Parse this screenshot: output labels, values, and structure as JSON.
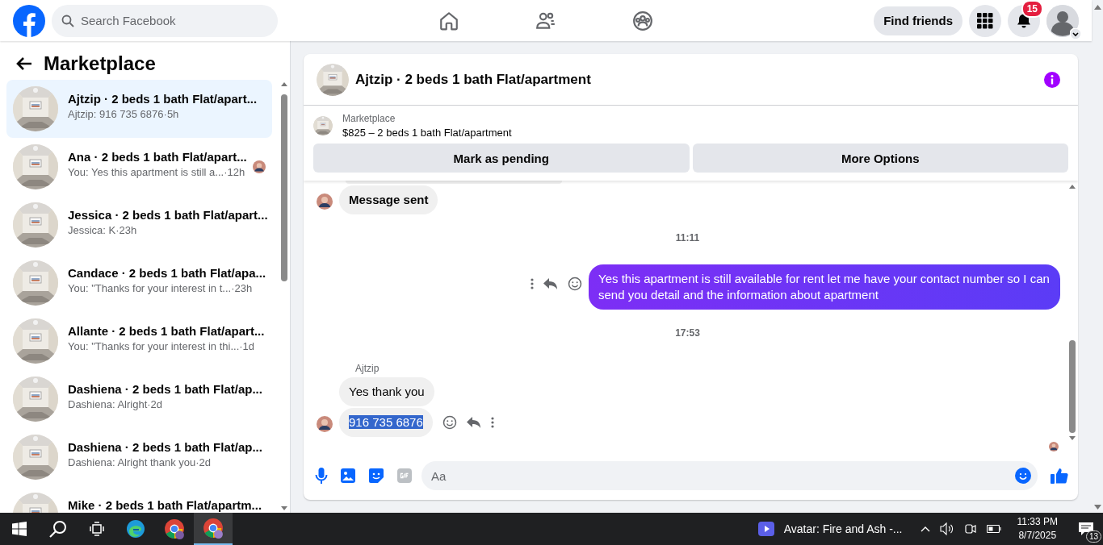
{
  "topbar": {
    "search": {
      "placeholder": "Search Facebook"
    },
    "nav": [
      {
        "kind": "home"
      },
      {
        "kind": "friends"
      },
      {
        "kind": "groups"
      }
    ],
    "find_friends": "Find friends",
    "notification_count": "15"
  },
  "sidebar": {
    "title": "Marketplace",
    "conversations": [
      {
        "title": "Ajtzip · 2 beds 1 bath Flat/apart...",
        "preview": "Ajtzip: 916 735 6876",
        "time": "·5h",
        "selected": true,
        "seen": false
      },
      {
        "title": "Ana · 2 beds 1 bath Flat/apart...",
        "preview": "You: Yes this apartment is still a...",
        "time": "·12h",
        "selected": false,
        "seen": true
      },
      {
        "title": "Jessica · 2 beds 1 bath Flat/apart...",
        "preview": "Jessica: K",
        "time": "·23h",
        "selected": false,
        "seen": false
      },
      {
        "title": "Candace · 2 beds 1 bath Flat/apa...",
        "preview": "You: \"Thanks for your interest in t...",
        "time": "·23h",
        "selected": false,
        "seen": false
      },
      {
        "title": "Allante · 2 beds 1 bath Flat/apart...",
        "preview": "You: \"Thanks for your interest in thi...",
        "time": "·1d",
        "selected": false,
        "seen": false
      },
      {
        "title": "Dashiena · 2 beds 1 bath Flat/ap...",
        "preview": "Dashiena: Alright",
        "time": "·2d",
        "selected": false,
        "seen": false
      },
      {
        "title": "Dashiena · 2 beds 1 bath Flat/ap...",
        "preview": "Dashiena: Alright thank you",
        "time": "·2d",
        "selected": false,
        "seen": false
      },
      {
        "title": "Mike · 2 beds 1 bath Flat/apartm..."
      }
    ]
  },
  "chat": {
    "title": "Ajtzip · 2 beds 1 bath Flat/apartment",
    "listing": {
      "label": "Marketplace",
      "summary": "$825 – 2 beds 1 bath Flat/apartment"
    },
    "actions": [
      "Mark as pending",
      "More Options"
    ],
    "messages": [
      {
        "kind": "received",
        "text": "Message sent",
        "avatar": true,
        "actions": false,
        "highlighted": false
      },
      {
        "kind": "time",
        "text": "11:11"
      },
      {
        "kind": "sent",
        "text": "Yes this apartment is still available for rent let me have your contact number so I can send you detail and the information about apartment",
        "actions": true
      },
      {
        "kind": "time",
        "text": "17:53"
      },
      {
        "kind": "sender",
        "text": "Ajtzip"
      },
      {
        "kind": "received",
        "text": "Yes thank you",
        "avatar": false,
        "actions": false,
        "highlighted": false
      },
      {
        "kind": "received",
        "text": "916 735 6876",
        "avatar": true,
        "actions": true,
        "highlighted": true
      }
    ],
    "seen": true,
    "composer": {
      "placeholder": "Aa"
    }
  },
  "taskbar": {
    "media": "Avatar: Fire and Ash -...",
    "time": "11:33 PM",
    "date": "8/7/2025",
    "notification_count": "13"
  }
}
